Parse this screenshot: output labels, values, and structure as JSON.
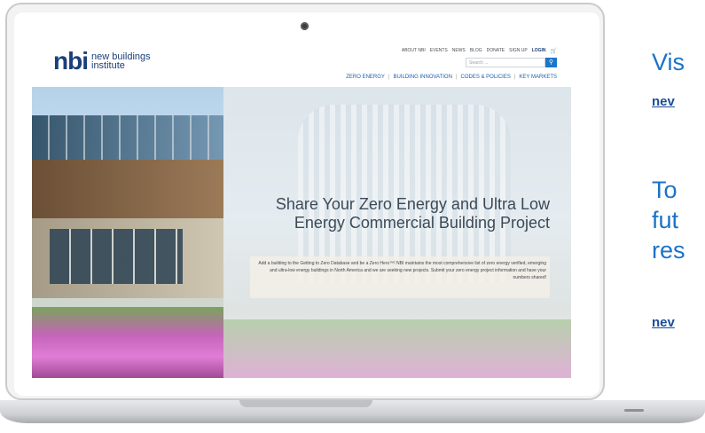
{
  "site": {
    "logo_mark": "nbi",
    "logo_line1": "new buildings",
    "logo_line2": "institute",
    "top_links": [
      "ABOUT NBI",
      "EVENTS",
      "NEWS",
      "BLOG",
      "DONATE",
      "SIGN UP"
    ],
    "login_label": "LOGIN",
    "search_placeholder": "Search ...",
    "main_nav": [
      "ZERO ENERGY",
      "BUILDING INNOVATION",
      "CODES & POLICIES",
      "KEY MARKETS"
    ]
  },
  "hero": {
    "title": "Share Your Zero Energy and Ultra Low Energy Commercial Building Project",
    "body": "Add a building to the Getting to Zero Database and be a Zero Hero™! NBI maintains the most comprehensive list of zero energy verified, emerging and ultra-low energy buildings in North America and we are seeking new projects. Submit your zero energy project information and have your numbers shared!"
  },
  "side": {
    "visit_text": "Vis",
    "link1": "nev",
    "para": "To\nfut\nres",
    "link2": "nev"
  },
  "colors": {
    "brand_navy": "#1b3f7a",
    "link_blue": "#1b5fb0",
    "accent_blue": "#1a73c8"
  }
}
